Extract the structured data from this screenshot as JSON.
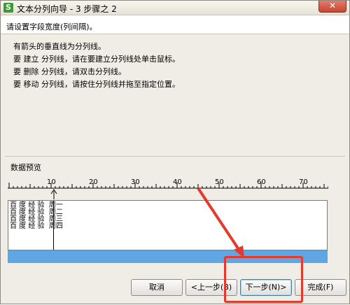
{
  "window": {
    "title": "文本分列向导 - 3 步骤之 2",
    "app_icon_letter": "S",
    "close_symbol": "✕"
  },
  "header": {
    "text": "请设置字段宽度(列间隔)。"
  },
  "instructions": [
    "有箭头的垂直线为分列线。",
    "要 建立 分列线，请在要建立分列线处单击鼠标。",
    "要 删除 分列线，请双击分列线。",
    "要 移动 分列线，请按住分列线并拖至指定位置。"
  ],
  "preview": {
    "label": "数据预览",
    "ruler_labels": [
      "10",
      "20",
      "30",
      "40",
      "50",
      "60",
      "70"
    ],
    "rows": [
      "百 度 经 验  周一",
      "百 度 经 验  周二",
      "百 度 经 验  周三",
      "百 度 经 验  周四"
    ]
  },
  "buttons": {
    "cancel": "取消",
    "back": "<上一步(B)",
    "next": "下一步(N)>",
    "finish": "完成(F)"
  },
  "colors": {
    "annotation": "#e53a2b",
    "selection": "#5ea6e4"
  }
}
